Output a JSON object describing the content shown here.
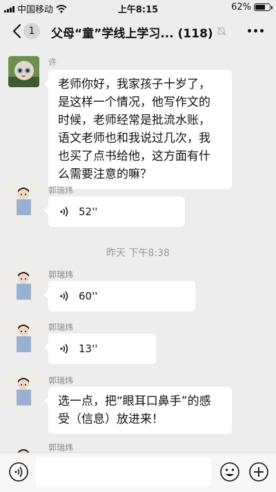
{
  "status_bar": {
    "carrier": "中国移动",
    "time": "上午8:15",
    "battery_percent": "62%",
    "battery_level": 0.62
  },
  "nav": {
    "unread_count": "1",
    "title": "父母“童”学线上学习...",
    "member_count": "(118)"
  },
  "messages": [
    {
      "type": "text",
      "sender": "许",
      "text_lines": [
        "老师你好，我家孩子十岁了，",
        "是这样一个情况，他写作文的",
        "时候，老师经常是批流水账，",
        "语文老师也和我说过几次，我",
        "也买了点书给他，这方面有什",
        "么需要注意的嘛？"
      ]
    },
    {
      "type": "voice",
      "sender": "郭瑞炜",
      "duration": "52''"
    },
    {
      "type": "time",
      "text": "昨天 下午8:38"
    },
    {
      "type": "voice",
      "sender": "郭瑞炜",
      "duration": "60''"
    },
    {
      "type": "voice",
      "sender": "郭瑞炜",
      "duration": "13''"
    },
    {
      "type": "text",
      "sender": "郭瑞炜",
      "text_lines": [
        "选一点，把“眼耳口鼻手”的感",
        "受（信息）放进来！"
      ]
    },
    {
      "type": "partial",
      "sender": "郭瑞炜"
    }
  ],
  "input_bar": {
    "placeholder": "",
    "value": ""
  },
  "icons": {
    "back": "chevron-left-icon",
    "mute": "bell-off-icon",
    "more": "more-dots-icon",
    "voice": "voice-wave-icon",
    "emoji": "emoji-icon",
    "add": "plus-circle-icon"
  }
}
